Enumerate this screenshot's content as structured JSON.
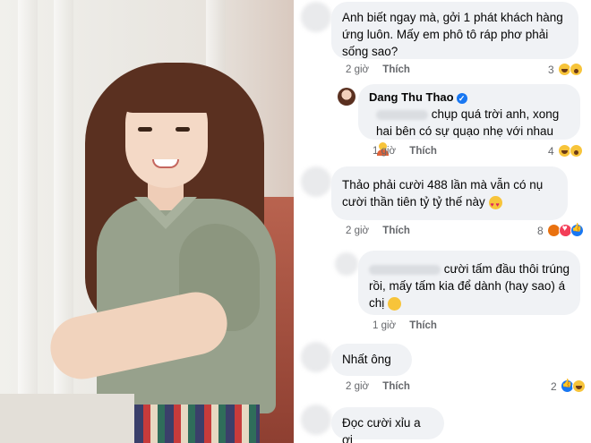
{
  "comments": [
    {
      "text": "Anh biết ngay mà, gởi 1 phát khách hàng ứng luôn. Mấy em phô tô ráp phơ phải sống sao?",
      "time": "2 giờ",
      "like": "Thích",
      "reaction_count": "3",
      "reactions": [
        "haha-icon",
        "wow-icon"
      ]
    },
    {
      "author": "Dang Thu Thao",
      "text_after_tag": "chụp quá trời anh, xong hai bên có sự quạo nhẹ với nhau",
      "time": "1 giờ",
      "like": "Thích",
      "reaction_count": "4",
      "reactions": [
        "haha-icon",
        "wow-icon"
      ]
    },
    {
      "text": "Thảo phải cười 488 lần mà vẫn có nụ cười thần tiên tỷ tỷ thế này",
      "time": "2 giờ",
      "like": "Thích",
      "reaction_count": "8",
      "reactions": [
        "angry-icon",
        "love-icon",
        "like-icon"
      ]
    },
    {
      "text_after_tag": "cười tấm đầu thôi trúng rồi, mấy tấm kia để dành (hay sao) á chị",
      "time": "1 giờ",
      "like": "Thích"
    },
    {
      "text": "Nhất ông",
      "time": "2 giờ",
      "like": "Thích",
      "reaction_count": "2",
      "reactions": [
        "like-icon",
        "haha-icon"
      ]
    },
    {
      "text": "Đọc cười xỉu a ơi"
    }
  ],
  "colors": {
    "bubble": "#f0f2f5",
    "meta": "#65676b",
    "verified": "#1877f2"
  }
}
